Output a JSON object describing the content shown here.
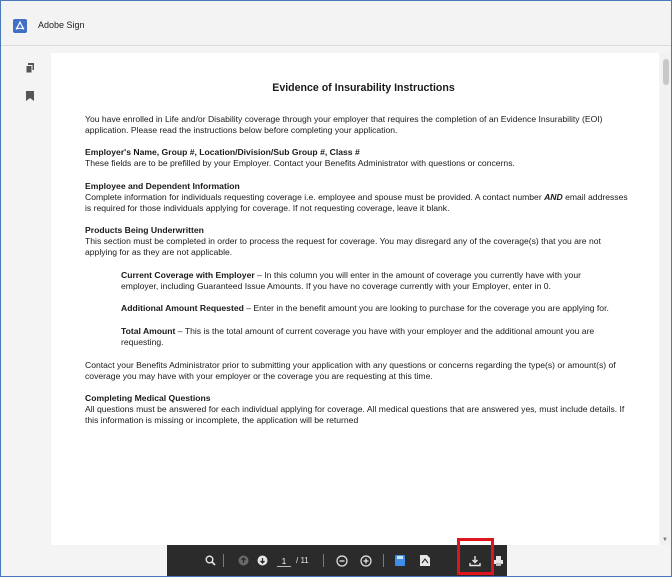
{
  "app": {
    "title": "Adobe Sign",
    "accent_color": "#3f6fc6",
    "highlight_color": "#e0141d"
  },
  "sidebar": {
    "items": [
      {
        "icon": "pages-icon"
      },
      {
        "icon": "bookmark-icon"
      }
    ]
  },
  "document": {
    "title": "Evidence of Insurability Instructions",
    "intro": "You have enrolled in Life and/or Disability coverage through your employer that requires the completion of an Evidence Insurability (EOI) application. Please read the instructions below before completing your application.",
    "sections": [
      {
        "heading": "Employer's Name, Group #, Location/Division/Sub Group #, Class #",
        "body": "These fields are to be prefilled by your Employer. Contact your Benefits Administrator with questions or concerns."
      },
      {
        "heading": "Employee and Dependent Information",
        "body_1": "Complete information for individuals requesting coverage i.e. employee and spouse must be provided. A contact number ",
        "body_emph": "AND",
        "body_2": " email addresses is required for those individuals applying for coverage. If not requesting coverage, leave it blank."
      },
      {
        "heading": "Products Being Underwritten",
        "body": "This section must be completed in order to process the request for coverage. You may disregard any of the coverage(s) that you are not applying for as they are not applicable."
      }
    ],
    "items": [
      {
        "term": "Current Coverage with Employer",
        "text": " – In this column you will enter in the amount of coverage you currently have with your employer, including Guaranteed Issue Amounts. If you have no coverage currently with your Employer, enter in 0."
      },
      {
        "term": "Additional Amount Requested",
        "text": " – Enter in the benefit amount you are looking to purchase for the coverage you are applying for."
      },
      {
        "term": "Total Amount",
        "text": " – This is the total amount of current coverage you have with your employer and the additional amount you are requesting."
      }
    ],
    "contact_text": "Contact your Benefits Administrator prior to submitting your application with any questions or concerns regarding the type(s) or amount(s) of coverage you may have with your employer or the coverage you are requesting at this time.",
    "medical": {
      "heading": "Completing Medical Questions",
      "body": "All questions must be answered for each individual applying for coverage. All medical questions that are answered yes, must include details. If this information is missing or incomplete, the application will be returned"
    }
  },
  "toolbar": {
    "current_page": "1",
    "total_pages": "/ 11",
    "buttons": [
      "search-icon",
      "prev-page-icon",
      "next-page-icon",
      "zoom-out-icon",
      "zoom-in-icon",
      "save-icon",
      "pdf-icon",
      "download-icon",
      "print-icon"
    ]
  }
}
